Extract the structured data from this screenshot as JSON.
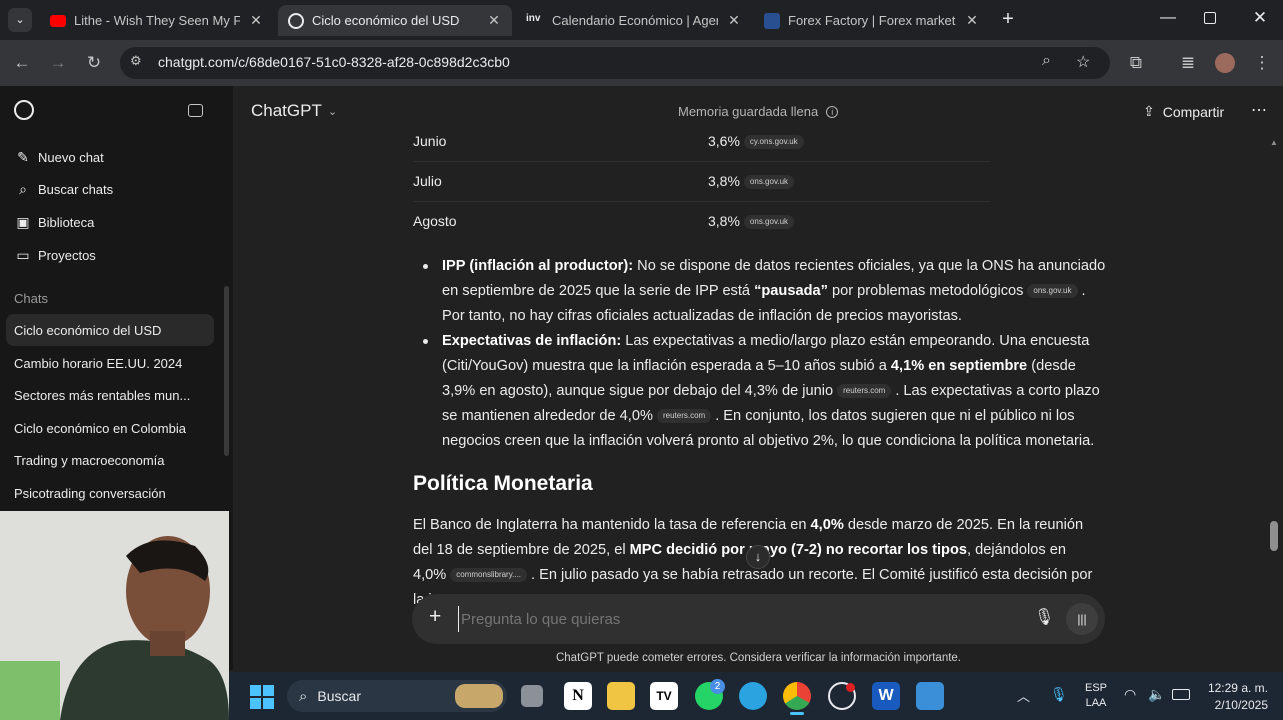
{
  "browser": {
    "tabs": [
      {
        "label": "Lithe - Wish They Seen My Face",
        "icon": "youtube-icon",
        "active": false
      },
      {
        "label": "Ciclo económico del USD",
        "icon": "chatgpt-icon",
        "active": true
      },
      {
        "label": "Calendario Económico | Agenda",
        "icon": "investing-icon",
        "active": false
      },
      {
        "label": "Forex Factory | Forex markets fo",
        "icon": "forexfactory-icon",
        "active": false
      }
    ],
    "new_tab_label": "+",
    "url": "chatgpt.com/c/68de0167-51c0-8328-af28-0c898d2c3cb0"
  },
  "sidebar": {
    "nav": [
      {
        "label": "Nuevo chat",
        "icon": "compose-icon"
      },
      {
        "label": "Buscar chats",
        "icon": "search-icon"
      },
      {
        "label": "Biblioteca",
        "icon": "library-icon"
      },
      {
        "label": "Proyectos",
        "icon": "folder-icon"
      }
    ],
    "chats_heading": "Chats",
    "chats": [
      "Ciclo económico del USD",
      "Cambio horario EE.UU. 2024",
      "Sectores más rentables mun...",
      "Ciclo económico en Colombia",
      "Trading y macroeconomía",
      "Psicotrading conversación"
    ]
  },
  "header": {
    "model": "ChatGPT",
    "memory_notice": "Memoria guardada llena",
    "share_label": "Compartir"
  },
  "content": {
    "table_rows": [
      {
        "month": "Junio",
        "value": "3,6%",
        "source": "cy.ons.gov.uk"
      },
      {
        "month": "Julio",
        "value": "3,8%",
        "source": "ons.gov.uk"
      },
      {
        "month": "Agosto",
        "value": "3,8%",
        "source": "ons.gov.uk"
      }
    ],
    "bullet1": {
      "bold": "IPP (inflación al productor):",
      "text1": " No se dispone de datos recientes oficiales, ya que la ONS ha anunciado en septiembre de 2025 que la serie de IPP está ",
      "bold2": "“pausada”",
      "text2": " por problemas metodológicos",
      "chip": "ons.gov.uk",
      "text3": ". Por tanto, no hay cifras oficiales actualizadas de inflación de precios mayoristas."
    },
    "bullet2": {
      "bold": "Expectativas de inflación:",
      "text1": " Las expectativas a medio/largo plazo están empeorando. Una encuesta (Citi/YouGov) muestra que la inflación esperada a 5–10 años subió a ",
      "bold2": "4,1% en septiembre",
      "text2": " (desde 3,9% en agosto), aunque sigue por debajo del 4,3% de junio",
      "chip1": "reuters.com",
      "text3": ". Las expectativas a corto plazo se mantienen alrededor de 4,0%",
      "chip2": "reuters.com",
      "text4": ". En conjunto, los datos sugieren que ni el público ni los negocios creen que la inflación volverá pronto al objetivo 2%, lo que condiciona la política monetaria."
    },
    "section_heading": "Política Monetaria",
    "paragraph": {
      "text1": "El Banco de Inglaterra ha mantenido la tasa de referencia en ",
      "bold1": "4,0%",
      "text2": " desde marzo de 2025. En la reunión del 18 de septiembre de 2025, el ",
      "bold2": "MPC decidió por mayo",
      "bold3": " (7-2) no recortar los tipos",
      "text3": ", dejándolos en 4,0%",
      "chip": "commonslibrary....",
      "text4": ". En julio pasado ya se había retrasado un recorte. El Comité justificó esta decisión por la",
      "text5": "in"
    }
  },
  "composer": {
    "placeholder": "Pregunta lo que quieras",
    "disclaimer": "ChatGPT puede cometer errores. Considera verificar la información importante."
  },
  "taskbar": {
    "search_label": "Buscar",
    "language": "ESP",
    "layout": "LAA",
    "time": "12:29 a. m.",
    "date": "2/10/2025",
    "whatsapp_badge": "2"
  },
  "colors": {
    "background": "#212121",
    "sidebar": "#171717",
    "chip": "#303030",
    "taskbar": "#1c2733"
  }
}
